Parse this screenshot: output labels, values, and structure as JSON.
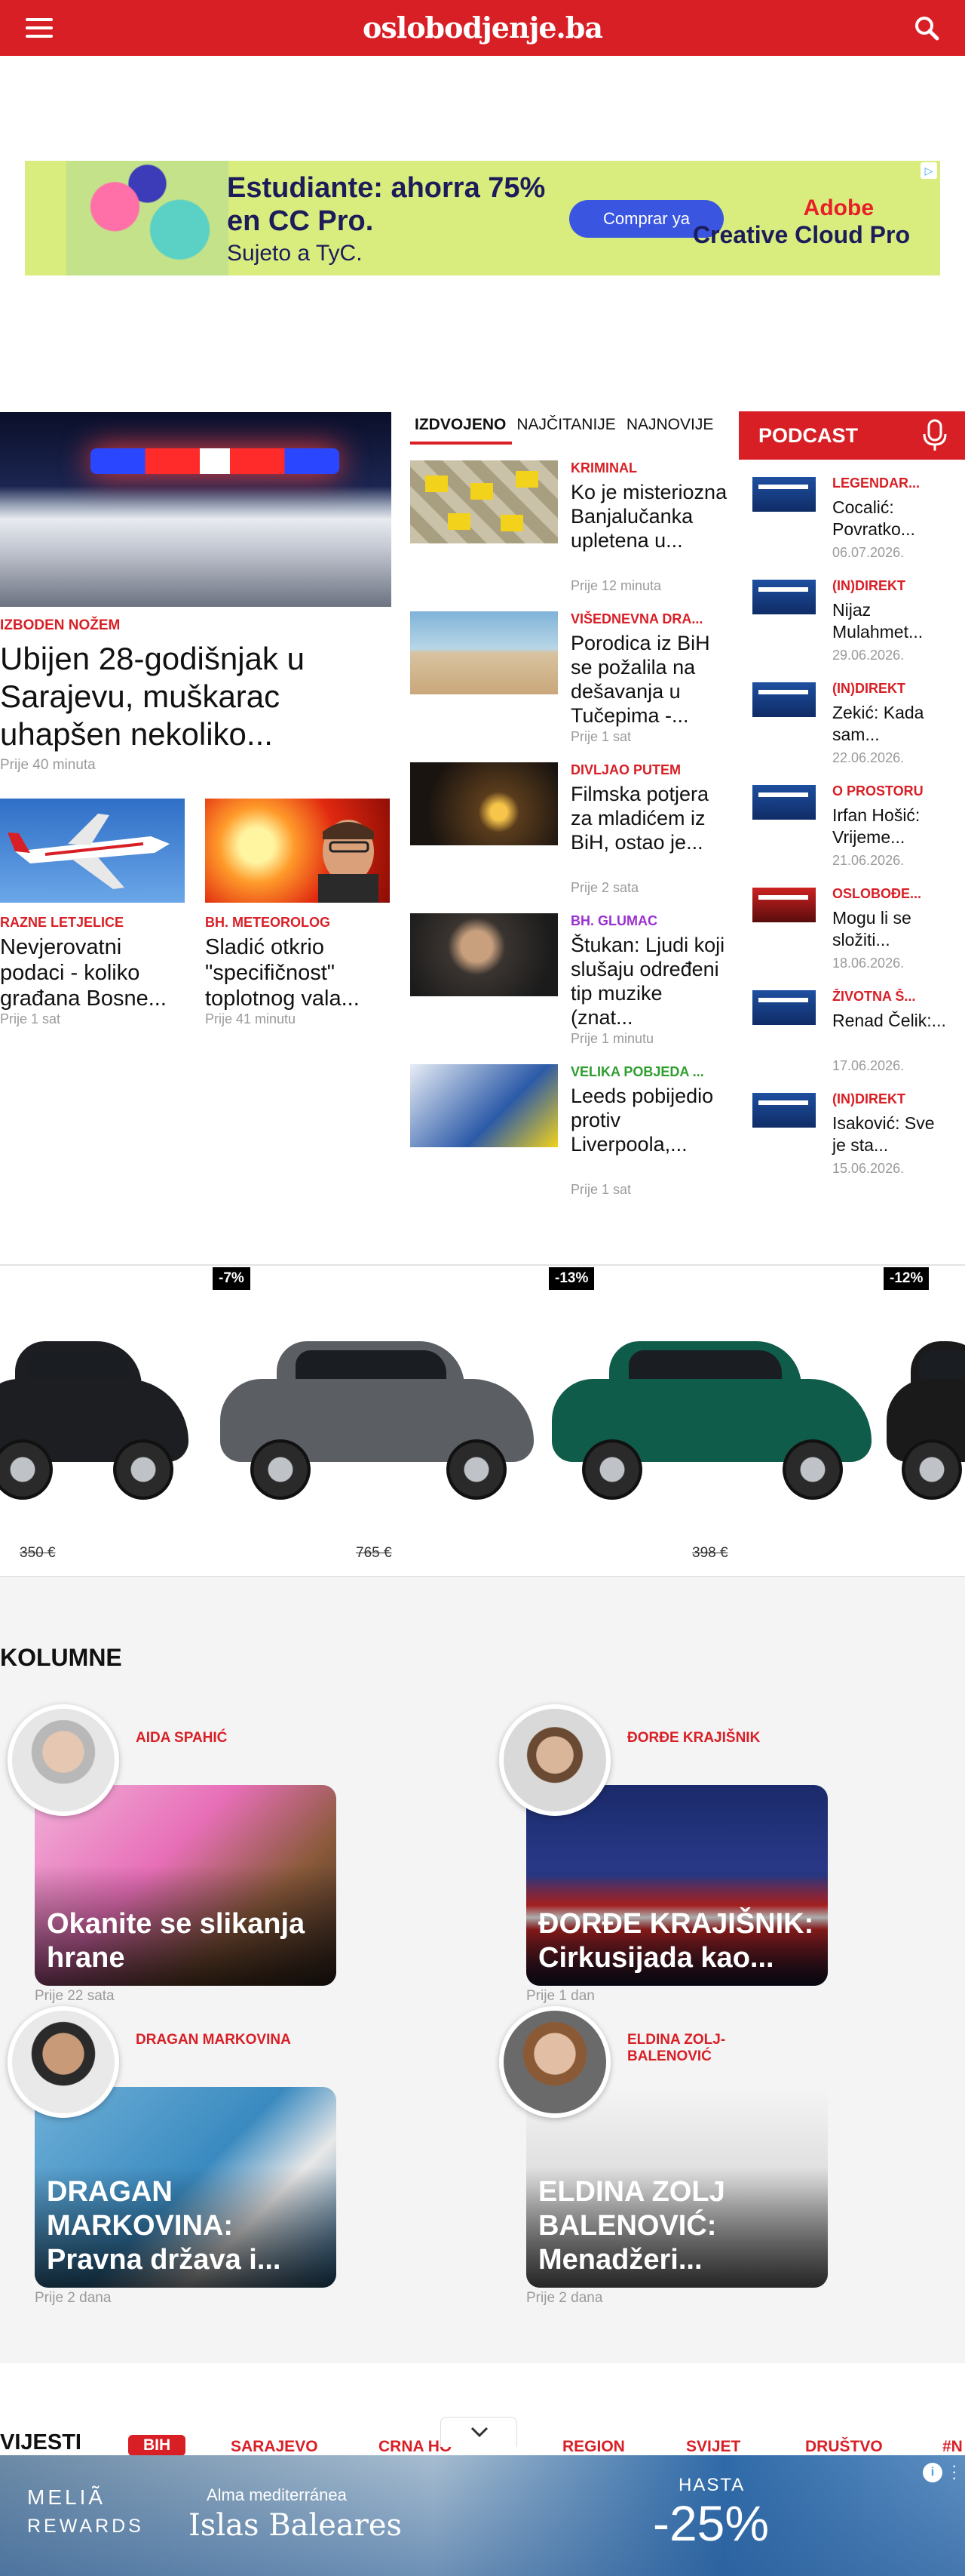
{
  "header": {
    "logo": "oslobodjenje.ba"
  },
  "ad_top": {
    "headline": "Estudiante: ahorra 75% en CC Pro.",
    "sub": "Sujeto a TyC.",
    "cta": "Comprar ya",
    "brand1": "Adobe",
    "brand2": "Creative Cloud Pro"
  },
  "lead": {
    "kicker": "IZBODEN NOŽEM",
    "title": "Ubijen 28-godišnjak u Sarajevu, muškarac uhapšen nekoliko...",
    "time": "Prije 40 minuta"
  },
  "sub_articles": [
    {
      "kicker": "RAZNE LETJELICE",
      "title": "Nevjerovatni podaci - koliko građana Bosne...",
      "time": "Prije 1 sat"
    },
    {
      "kicker": "BH. METEOROLOG",
      "title": "Sladić otkrio \"specifičnost\" toplotnog vala...",
      "time": "Prije 41 minutu"
    }
  ],
  "tabs": [
    "IZDVOJENO",
    "NAJČITANIJE",
    "NAJNOVIJE"
  ],
  "featured": [
    {
      "kicker": "KRIMINAL",
      "kicker_color": "#d81f26",
      "title": "Ko je misteriozna Banjalučanka upletena u...",
      "time": "Prije 12 minuta"
    },
    {
      "kicker": "VIŠEDNEVNA DRA...",
      "kicker_color": "#d81f26",
      "title": "Porodica iz BiH se požalila na dešavanja u Tučepima -...",
      "time": "Prije 1 sat"
    },
    {
      "kicker": "DIVLJAO PUTEM",
      "kicker_color": "#d81f26",
      "title": "Filmska potjera za mladićem iz BiH, ostao je...",
      "time": "Prije 2 sata"
    },
    {
      "kicker": "BH. GLUMAC",
      "kicker_color": "#9b30d0",
      "title": "Štukan: Ljudi koji slušaju određeni tip muzike (znat...",
      "time": "Prije 1 minutu"
    },
    {
      "kicker": "VELIKA POBJEDA ...",
      "kicker_color": "#2f9e2f",
      "title": "Leeds pobijedio protiv Liverpoola,...",
      "time": "Prije 1 sat"
    }
  ],
  "podcast": {
    "title": "PODCAST",
    "items": [
      {
        "kicker": "LEGENDAR...",
        "title": "Cocalić: Povratko...",
        "date": "06.07.2026."
      },
      {
        "kicker": "(IN)DIREKT",
        "title": "Nijaz Mulahmet...",
        "date": "29.06.2026."
      },
      {
        "kicker": "(IN)DIREKT",
        "title": "Zekić: Kada sam...",
        "date": "22.06.2026."
      },
      {
        "kicker": "O PROSTORU",
        "title": "Irfan Hošić: Vrijeme...",
        "date": "21.06.2026."
      },
      {
        "kicker": "OSLOBOĐE...",
        "title": "Mogu li se složiti...",
        "date": "18.06.2026."
      },
      {
        "kicker": "ŽIVOTNA Š...",
        "title": "Renad Čelik:...",
        "date": "17.06.2026."
      },
      {
        "kicker": "(IN)DIREKT",
        "title": "Isaković: Sve je sta...",
        "date": "15.06.2026."
      }
    ]
  },
  "cars": {
    "discounts": [
      "-7%",
      "-13%",
      "-12%"
    ],
    "old_prices": [
      "350 €",
      "765 €",
      "398 €"
    ],
    "colors": [
      "#1c1e22",
      "#5b5e63",
      "#0f5c4a",
      "#1a1a1a"
    ]
  },
  "kolumne": {
    "title": "KOLUMNE",
    "items": [
      {
        "author": "AIDA SPAHIĆ",
        "title": "Okanite se slikanja hrane",
        "date": "Prije 22 sata"
      },
      {
        "author": "ĐORĐE KRAJIŠNIK",
        "title": "ĐORĐE KRAJIŠNIK: Cirkusijada kao...",
        "date": "Prije 1 dan"
      },
      {
        "author": "DRAGAN MARKOVINA",
        "title": "DRAGAN MARKOVINA: Pravna država i...",
        "date": "Prije 2 dana"
      },
      {
        "author": "ELDINA ZOLJ-BALENOVIĆ",
        "title": "ELDINA ZOLJ BALENOVIĆ: Menadžeri...",
        "date": "Prije 2 dana"
      }
    ]
  },
  "vijesti": {
    "title": "VIJESTI",
    "categories": [
      "BIH",
      "SARAJEVO",
      "CRNA HO",
      "REGION",
      "SVIJET",
      "DRUŠTVO",
      "#N"
    ]
  },
  "ad_bottom": {
    "brand1": "MELIÃ",
    "brand2": "REWARDS",
    "line1": "Alma mediterránea",
    "line2": "Islas Baleares",
    "hasta": "HASTA",
    "pct": "-25%"
  }
}
